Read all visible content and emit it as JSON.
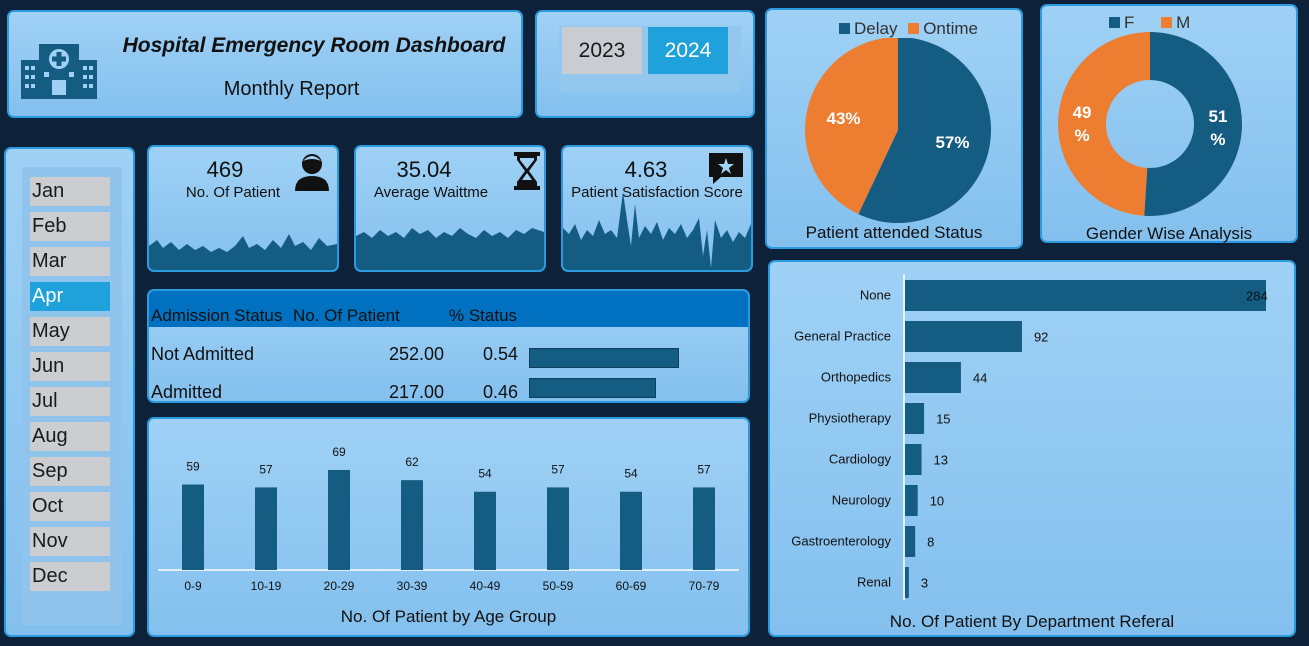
{
  "header": {
    "title": "Hospital Emergency Room Dashboard",
    "subtitle": "Monthly Report"
  },
  "years": [
    "2023",
    "2024"
  ],
  "selected_year": "2024",
  "months": [
    "Jan",
    "Feb",
    "Mar",
    "Apr",
    "May",
    "Jun",
    "Jul",
    "Aug",
    "Sep",
    "Oct",
    "Nov",
    "Dec"
  ],
  "selected_month": "Apr",
  "kpis": {
    "patients": {
      "value": "469",
      "label": "No. Of Patient",
      "icon": "person-icon"
    },
    "wait": {
      "value": "35.04",
      "label": "Average Waittme",
      "icon": "hourglass-icon"
    },
    "satisfaction": {
      "value": "4.63",
      "label": "Patient Satisfaction Score",
      "icon": "star-review-icon"
    }
  },
  "admission": {
    "headers": [
      "Admission Status",
      "No. Of Patient",
      "% Status"
    ],
    "rows": [
      {
        "status": "Not Admitted",
        "count": "252.00",
        "pct": "0.54",
        "pct_value": 0.54
      },
      {
        "status": "Admitted",
        "count": "217.00",
        "pct": "0.46",
        "pct_value": 0.46
      }
    ]
  },
  "colors": {
    "navy": "#145c82",
    "orange": "#ed7d31",
    "accent": "#1fa1db"
  },
  "chart_data": [
    {
      "type": "bar",
      "title": "No. Of Patient by Age Group",
      "categories": [
        "0-9",
        "10-19",
        "20-29",
        "30-39",
        "40-49",
        "50-59",
        "60-69",
        "70-79"
      ],
      "values": [
        59,
        57,
        69,
        62,
        54,
        57,
        54,
        57
      ],
      "ylim": [
        0,
        75
      ],
      "grid": false
    },
    {
      "type": "pie",
      "title": "Patient attended Status",
      "legend": "top",
      "categories": [
        "Delay",
        "Ontime"
      ],
      "values": [
        57,
        43
      ],
      "labels": [
        "57%",
        "43%"
      ]
    },
    {
      "type": "pie",
      "title": "Gender Wise Analysis",
      "legend": "top",
      "categories": [
        "F",
        "M"
      ],
      "values": [
        51,
        49
      ],
      "labels": [
        [
          "51",
          "%"
        ],
        [
          "49",
          "%"
        ]
      ]
    },
    {
      "type": "bar",
      "orientation": "horizontal",
      "title": "No. Of Patient By Department Referal",
      "categories": [
        "None",
        "General Practice",
        "Orthopedics",
        "Physiotherapy",
        "Cardiology",
        "Neurology",
        "Gastroenterology",
        "Renal"
      ],
      "values": [
        284,
        92,
        44,
        15,
        13,
        10,
        8,
        3
      ],
      "xlim": [
        0,
        284
      ]
    }
  ]
}
